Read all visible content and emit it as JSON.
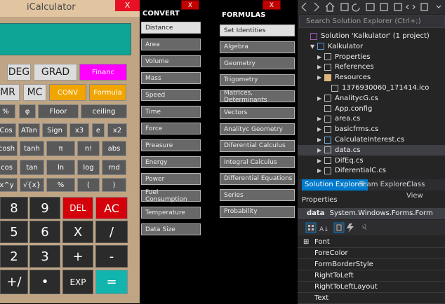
{
  "calculator": {
    "title": "iCalculator",
    "close": "X",
    "rows": [
      [
        "DEG",
        "GRAD",
        "Financ"
      ],
      [
        "MR",
        "MC",
        "CONV",
        "Formula"
      ],
      [
        "%",
        "φ",
        "Floor",
        "ceiling"
      ],
      [
        "Cos",
        "ATan",
        "Sign",
        "x3",
        "e",
        "x2"
      ],
      [
        "cosh",
        "tanh",
        "π",
        "n!",
        "abs"
      ],
      [
        "cos",
        "tan",
        "ln",
        "log",
        "rnd"
      ],
      [
        "x^y",
        "√{x}",
        "%",
        "(",
        ")"
      ],
      [
        "8",
        "9",
        "DEL",
        "AC"
      ],
      [
        "5",
        "6",
        "X",
        "/"
      ],
      [
        "2",
        "3",
        "+",
        "-"
      ],
      [
        "+/",
        "•",
        "EXP",
        "="
      ]
    ]
  },
  "convert": {
    "heading": "CONVERT",
    "close": "X",
    "items": [
      "Distance",
      "Area",
      "Volume",
      "Mass",
      "Speed",
      "Time",
      "Force",
      "Preasure",
      "Energy",
      "Power",
      "Fuel Consumption",
      "Temperature",
      "Data Size"
    ]
  },
  "formulas": {
    "heading": "FORMULAS",
    "close": "X",
    "items": [
      "Set Identities",
      "Algebra",
      "Geometry",
      "Trigometry",
      "Matrices, Determinants",
      "Vectors",
      "Analityc Geometry",
      "Diferential Calculus",
      "Integral Calculus",
      "Differential Equations",
      "Series",
      "Probability"
    ]
  },
  "solution_explorer": {
    "search_placeholder": "Search Solution Explorer (Ctrl+;)",
    "items": [
      {
        "label": "Solution 'Kalkulator' (1 project)",
        "icon": "solution-icon",
        "indent": 0,
        "exp": ""
      },
      {
        "label": "Kalkulator",
        "icon": "csharp-project-icon",
        "indent": 1,
        "exp": "▼"
      },
      {
        "label": "Properties",
        "icon": "wrench-icon",
        "indent": 2,
        "exp": "▶"
      },
      {
        "label": "References",
        "icon": "references-icon",
        "indent": 2,
        "exp": "▶"
      },
      {
        "label": "Resources",
        "icon": "folder-icon",
        "indent": 2,
        "exp": "▶"
      },
      {
        "label": "1376930060_171414.ico",
        "icon": "file-icon",
        "indent": 3,
        "exp": ""
      },
      {
        "label": "AnalitycG.cs",
        "icon": "form-icon",
        "indent": 2,
        "exp": "▶"
      },
      {
        "label": "App.config",
        "icon": "config-icon",
        "indent": 2,
        "exp": ""
      },
      {
        "label": "area.cs",
        "icon": "form-icon",
        "indent": 2,
        "exp": "▶"
      },
      {
        "label": "basicfrms.cs",
        "icon": "form-icon",
        "indent": 2,
        "exp": "▶"
      },
      {
        "label": "CalculateInterest.cs",
        "icon": "csharp-file-icon",
        "indent": 2,
        "exp": "▶"
      },
      {
        "label": "data.cs",
        "icon": "form-icon",
        "indent": 2,
        "exp": "▶",
        "selected": true
      },
      {
        "label": "DifEq.cs",
        "icon": "form-icon",
        "indent": 2,
        "exp": "▶"
      },
      {
        "label": "DiferentialC.cs",
        "icon": "form-icon",
        "indent": 2,
        "exp": "▶"
      }
    ],
    "tabs": [
      "Solution Explorer",
      "Team Explorer",
      "Class View"
    ]
  },
  "properties": {
    "heading": "Properties",
    "object_name": "data",
    "object_type": "System.Windows.Forms.Form",
    "rows": [
      {
        "label": "Font",
        "exp": "⊞"
      },
      {
        "label": "ForeColor",
        "exp": ""
      },
      {
        "label": "FormBorderStyle",
        "exp": ""
      },
      {
        "label": "RightToLeft",
        "exp": ""
      },
      {
        "label": "RightToLeftLayout",
        "exp": ""
      },
      {
        "label": "Text",
        "exp": ""
      }
    ]
  },
  "colors": {
    "accent": "#007acc",
    "calc_display": "#0ea596",
    "pink": "#ff00ff",
    "orange": "#f0a500",
    "red": "#d4000a"
  }
}
